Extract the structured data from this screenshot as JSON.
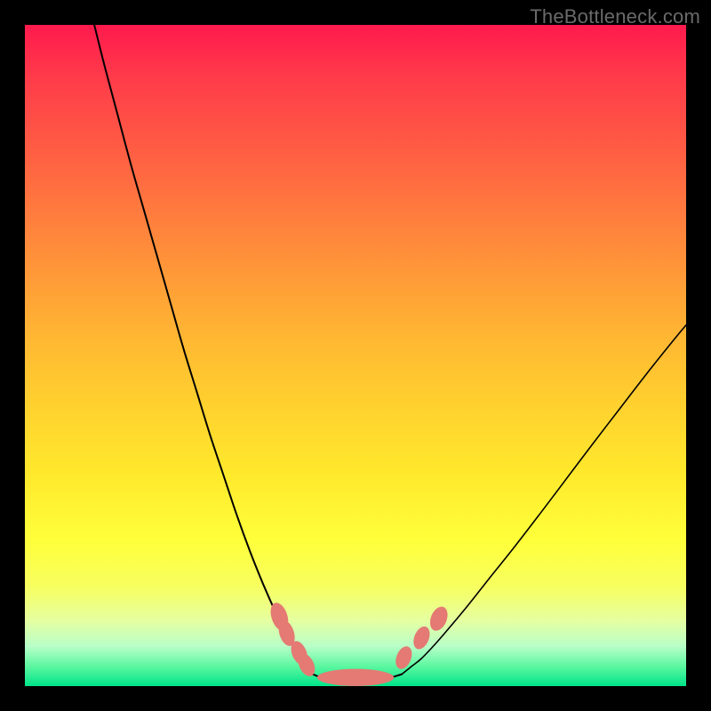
{
  "watermark": {
    "text": "TheBottleneck.com"
  },
  "colors": {
    "curve_stroke": "#000000",
    "marker_fill": "#e47a73",
    "marker_stroke": "#d66a63",
    "background_black": "#000000"
  },
  "chart_data": {
    "type": "line",
    "title": "",
    "xlabel": "",
    "ylabel": "",
    "xlim": [
      0,
      100
    ],
    "ylim": [
      0,
      100
    ],
    "grid": false,
    "legend": false,
    "series": [
      {
        "name": "left-branch",
        "x": [
          10.5,
          12,
          14,
          16,
          18,
          20,
          22,
          24,
          26,
          28,
          30,
          32,
          34,
          36,
          38,
          40,
          42,
          43.5
        ],
        "y": [
          100,
          94,
          86.5,
          79,
          72,
          65,
          58,
          51,
          44.5,
          38,
          32,
          26,
          20.5,
          15.5,
          11,
          7,
          3.5,
          1.8
        ]
      },
      {
        "name": "right-branch",
        "x": [
          57,
          58.5,
          60,
          62,
          64,
          67,
          70,
          74,
          78,
          82,
          86,
          90,
          94,
          98,
          100
        ],
        "y": [
          1.8,
          3.0,
          4.2,
          6.3,
          8.6,
          12.2,
          16.0,
          21.0,
          26.2,
          31.5,
          36.8,
          42.0,
          47.2,
          52.2,
          54.6
        ]
      },
      {
        "name": "flat-bottom",
        "x": [
          43.5,
          46,
          50,
          54,
          57
        ],
        "y": [
          1.8,
          1.0,
          0.8,
          1.0,
          1.8
        ]
      }
    ],
    "markers": [
      {
        "x": 38.5,
        "y": 10.5,
        "rx": 1.2,
        "ry": 2.2,
        "rot": -18
      },
      {
        "x": 39.6,
        "y": 8.0,
        "rx": 1.1,
        "ry": 2.0,
        "rot": -18
      },
      {
        "x": 41.5,
        "y": 5.0,
        "rx": 1.1,
        "ry": 1.9,
        "rot": -22
      },
      {
        "x": 42.6,
        "y": 3.2,
        "rx": 1.1,
        "ry": 1.8,
        "rot": -25
      },
      {
        "x": 57.3,
        "y": 4.3,
        "rx": 1.1,
        "ry": 1.8,
        "rot": 22
      },
      {
        "x": 60.0,
        "y": 7.3,
        "rx": 1.1,
        "ry": 1.8,
        "rot": 22
      },
      {
        "x": 62.6,
        "y": 10.2,
        "rx": 1.2,
        "ry": 1.9,
        "rot": 22
      },
      {
        "x": 50.0,
        "y": 1.3,
        "rx": 5.8,
        "ry": 1.3,
        "rot": 0
      }
    ]
  }
}
